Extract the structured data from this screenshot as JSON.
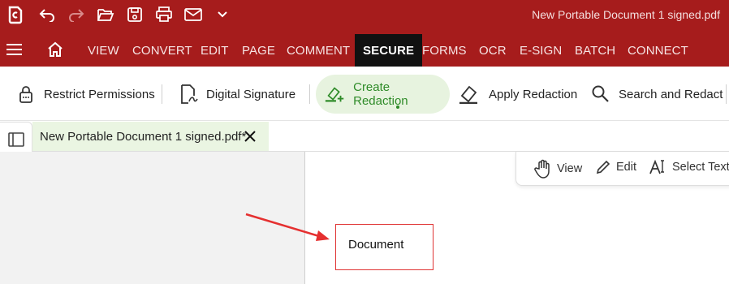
{
  "window": {
    "title": "New Portable Document 1 signed.pdf"
  },
  "titlebar_icons": [
    "app-logo-icon",
    "undo-icon",
    "redo-icon",
    "open-folder-icon",
    "save-icon",
    "print-icon",
    "email-icon",
    "chevron-down-icon"
  ],
  "menu": {
    "items": [
      {
        "label": "VIEW"
      },
      {
        "label": "CONVERT"
      },
      {
        "label": "EDIT"
      },
      {
        "label": "PAGE"
      },
      {
        "label": "COMMENT"
      },
      {
        "label": "SECURE",
        "active": true
      },
      {
        "label": "FORMS"
      },
      {
        "label": "OCR"
      },
      {
        "label": "E-SIGN"
      },
      {
        "label": "BATCH"
      },
      {
        "label": "CONNECT"
      }
    ]
  },
  "toolbar": {
    "restrict_permissions": "Restrict Permissions",
    "digital_signature": "Digital Signature",
    "create_redaction": "Create Redaction",
    "apply_redaction": "Apply Redaction",
    "search_and_redact": "Search and Redact"
  },
  "document_tab": {
    "label": "New Portable Document 1 signed.pdf*"
  },
  "view_bar": {
    "view": "View",
    "edit": "Edit",
    "select_text": "Select Text"
  },
  "page_content": {
    "text_box": "Document"
  },
  "colors": {
    "brand_red": "#a61c1c",
    "active_menu_bg": "#111111",
    "active_tool_bg": "#e7f3df",
    "active_tool_text": "#2e8b28",
    "annotation_red": "#e03434"
  }
}
